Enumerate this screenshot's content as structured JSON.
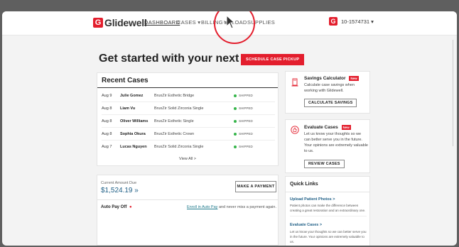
{
  "nav": {
    "logo_mark": "G",
    "logo_text": "Glidewell",
    "items": [
      {
        "label": "DASHBOARD",
        "active": true
      },
      {
        "label": "CASES ▾",
        "active": false
      },
      {
        "label": "BILLING ▾",
        "active": false
      },
      {
        "label": "UPLOAD",
        "active": false
      },
      {
        "label": "SUPPLIES",
        "active": false
      }
    ],
    "account_mark": "G",
    "account_label": "10-1574731 ▾"
  },
  "heading": "Get started with your next case",
  "pickup_button": "SCHEDULE CASE PICKUP",
  "recent_cases": {
    "title": "Recent Cases",
    "rows": [
      {
        "date": "Aug 9",
        "name": "Julie Gomez",
        "product": "BruxZir Esthetic Bridge",
        "status": "SHIPPED"
      },
      {
        "date": "Aug 8",
        "name": "Liam Vu",
        "product": "BruxZir Solid Zirconia Single",
        "status": "SHIPPED"
      },
      {
        "date": "Aug 8",
        "name": "Oliver Williams",
        "product": "BruxZir Esthetic Single",
        "status": "SHIPPED"
      },
      {
        "date": "Aug 8",
        "name": "Sophia Okura",
        "product": "BruxZir Esthetic Crown",
        "status": "SHIPPED"
      },
      {
        "date": "Aug 7",
        "name": "Lucas Nguyen",
        "product": "BruxZir Solid Zirconia Single",
        "status": "SHIPPED"
      }
    ],
    "view_all": "View All >"
  },
  "amount": {
    "label": "Current Amount Due",
    "value": "$1,524.19 »",
    "pay_button": "MAKE A PAYMENT",
    "autopay_label": "Auto Pay Off",
    "autopay_marker": "●",
    "enroll_link": "Enroll in Auto Pay",
    "enroll_rest": "and never miss a payment again."
  },
  "savings": {
    "title": "Savings Calculator",
    "badge": "New",
    "text": "Calculate case savings when working with Glidewell.",
    "button": "CALCULATE SAVINGS"
  },
  "evaluate": {
    "title": "Evaluate Cases",
    "badge": "New",
    "text": "Let us know your thoughts so we can better serve you in the future. Your opinions are extremely valuable to us.",
    "button": "REVIEW CASES"
  },
  "quick_links": {
    "title": "Quick Links",
    "items": [
      {
        "label": "Upload Patient Photos >",
        "desc": "Patient photos can make the difference between creating a great restoration and an extraordinary one."
      },
      {
        "label": "Evaluate Cases >",
        "desc": "Let us know your thoughts so we can better serve you in the future. Your opinions are extremely valuable to us."
      }
    ]
  },
  "colors": {
    "brand_red": "#e31e2d",
    "link_blue": "#1f5f86",
    "shipped_green": "#35b54a"
  },
  "icons": [
    "cursor-arrow-icon",
    "calculator-icon",
    "thumbs-up-icon"
  ]
}
